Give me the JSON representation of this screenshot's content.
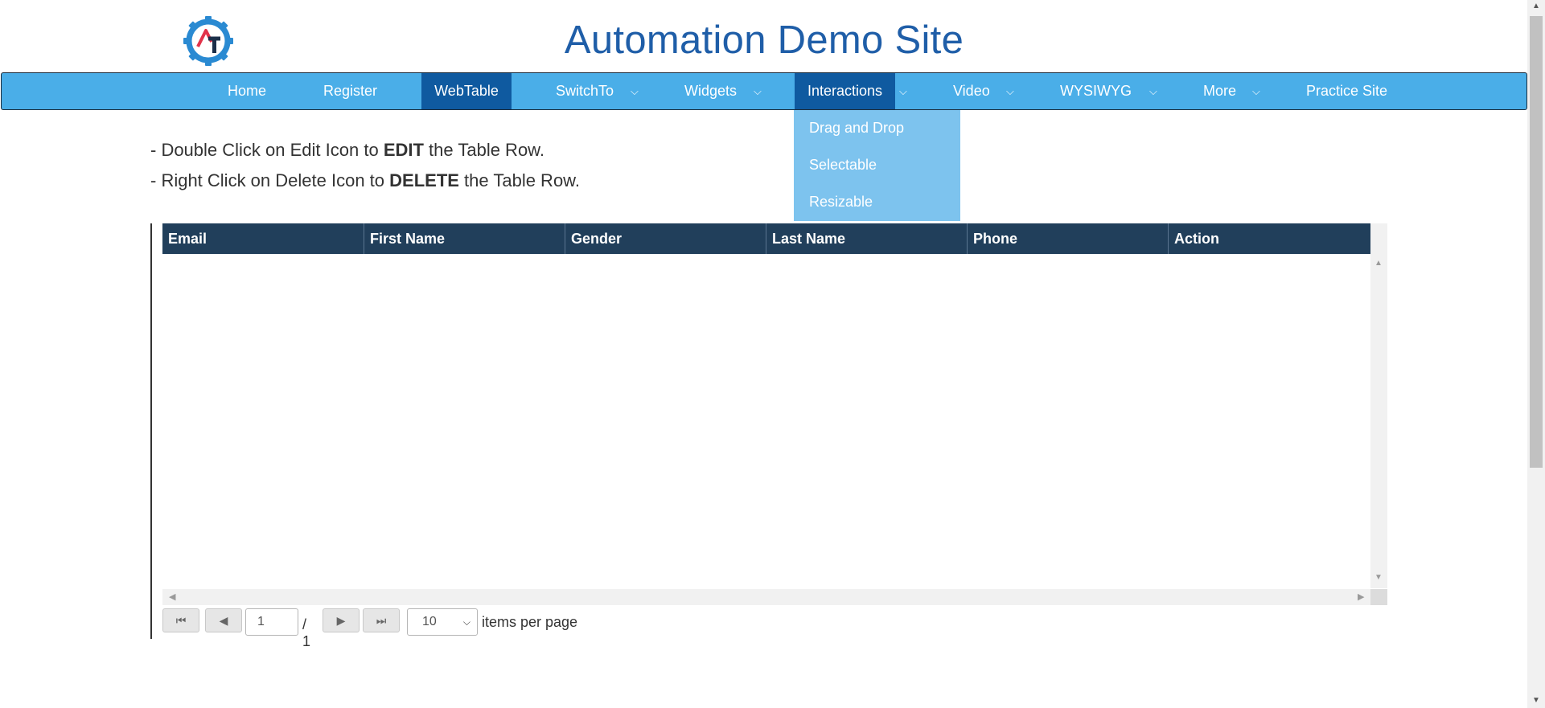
{
  "header": {
    "title": "Automation Demo Site",
    "logo_icon": "gear-logo-icon"
  },
  "nav": {
    "items": [
      {
        "label": "Home"
      },
      {
        "label": "Register"
      },
      {
        "label": "WebTable",
        "active": true
      },
      {
        "label": "SwitchTo",
        "has_dropdown": true
      },
      {
        "label": "Widgets",
        "has_dropdown": true
      },
      {
        "label": "Interactions",
        "has_dropdown": true,
        "open": true
      },
      {
        "label": "Video",
        "has_dropdown": true
      },
      {
        "label": "WYSIWYG",
        "has_dropdown": true
      },
      {
        "label": "More",
        "has_dropdown": true
      },
      {
        "label": "Practice Site"
      }
    ],
    "dropdown_items": [
      "Drag and Drop",
      "Selectable",
      "Resizable"
    ]
  },
  "instructions": {
    "line1_pre": "- Double Click on Edit Icon to ",
    "line1_bold": "EDIT",
    "line1_post": " the Table Row.",
    "line2_pre": "- Right Click on Delete Icon to ",
    "line2_bold": "DELETE",
    "line2_post": " the Table Row."
  },
  "table": {
    "columns": [
      "Email",
      "First Name",
      "Gender",
      "Last Name",
      "Phone",
      "Action"
    ],
    "rows": []
  },
  "pager": {
    "current_page": "1",
    "of_text": "/ 1",
    "page_size": "10",
    "items_per_page_label": "items per page"
  },
  "colors": {
    "title": "#1f5ea8",
    "navbar": "#4aaee8",
    "nav_active": "#0f5aa0",
    "dropdown": "#7dc3ee",
    "table_header": "#213f5b"
  }
}
